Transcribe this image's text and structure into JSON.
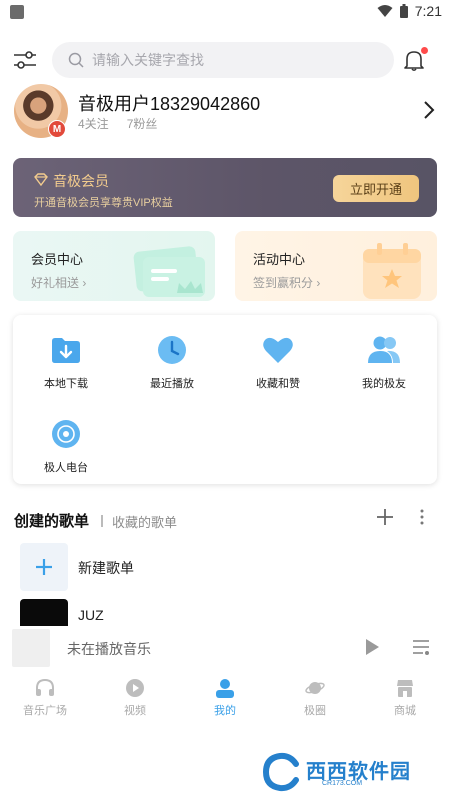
{
  "status_bar": {
    "time": "7:21"
  },
  "search": {
    "placeholder": "请输入关键字查找"
  },
  "profile": {
    "username": "音极用户18329042860",
    "following": "4关注",
    "followers": "7粉丝",
    "avatar_badge": "M"
  },
  "vip": {
    "title": "音极会员",
    "subtitle": "开通音极会员享尊贵VIP权益",
    "button": "立即开通",
    "accent": "#f3cc8e"
  },
  "centers": [
    {
      "title": "会员中心",
      "subtitle": "好礼相送 ›",
      "icon": "membership-card-icon"
    },
    {
      "title": "活动中心",
      "subtitle": "签到赢积分 ›",
      "icon": "calendar-star-icon"
    }
  ],
  "grid": [
    {
      "label": "本地下载",
      "icon": "download-folder-icon"
    },
    {
      "label": "最近播放",
      "icon": "clock-icon"
    },
    {
      "label": "收藏和赞",
      "icon": "heart-icon"
    },
    {
      "label": "我的极友",
      "icon": "friends-icon"
    },
    {
      "label": "极人电台",
      "icon": "radio-disc-icon"
    }
  ],
  "playlists_section": {
    "title": "创建的歌单",
    "tab_collected": "收藏的歌单"
  },
  "playlists": [
    {
      "name": "新建歌单",
      "icon": "plus-icon"
    },
    {
      "name": "JUZ",
      "icon": "album-cover"
    }
  ],
  "mini_player": {
    "text": "未在播放音乐"
  },
  "bottom_nav": [
    {
      "label": "音乐广场",
      "icon": "headphones-icon",
      "active": false
    },
    {
      "label": "视频",
      "icon": "video-play-icon",
      "active": false
    },
    {
      "label": "我的",
      "icon": "user-icon",
      "active": true
    },
    {
      "label": "极圈",
      "icon": "planet-icon",
      "active": false
    },
    {
      "label": "商城",
      "icon": "shop-icon",
      "active": false
    }
  ],
  "watermark": {
    "text": "西西软件园",
    "sub": "CR173.COM"
  },
  "colors": {
    "primary": "#3aa0e8",
    "vip_bg": "#5d5568"
  }
}
